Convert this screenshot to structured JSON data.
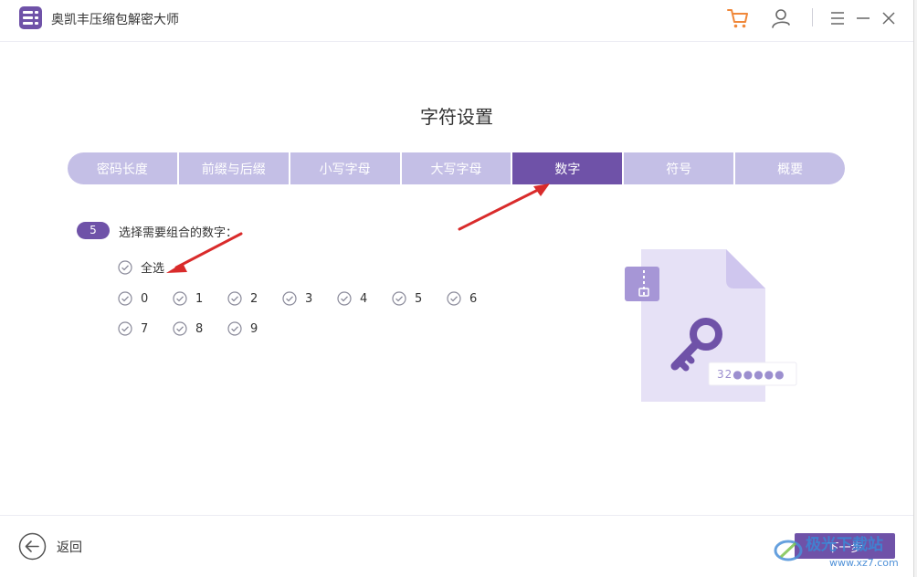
{
  "app": {
    "title": "奥凯丰压缩包解密大师"
  },
  "page": {
    "title": "字符设置"
  },
  "tabs": [
    {
      "label": "密码长度"
    },
    {
      "label": "前缀与后缀"
    },
    {
      "label": "小写字母"
    },
    {
      "label": "大写字母"
    },
    {
      "label": "数字",
      "active": true
    },
    {
      "label": "符号"
    },
    {
      "label": "概要"
    }
  ],
  "step": {
    "number": "5",
    "text": "选择需要组合的数字："
  },
  "select_all": {
    "label": "全选",
    "checked": true
  },
  "digits": [
    {
      "label": "0",
      "checked": true
    },
    {
      "label": "1",
      "checked": true
    },
    {
      "label": "2",
      "checked": true
    },
    {
      "label": "3",
      "checked": true
    },
    {
      "label": "4",
      "checked": true
    },
    {
      "label": "5",
      "checked": true
    },
    {
      "label": "6",
      "checked": true
    },
    {
      "label": "7",
      "checked": true
    },
    {
      "label": "8",
      "checked": true
    },
    {
      "label": "9",
      "checked": true
    }
  ],
  "illustration": {
    "password_hint": "32●●●●●"
  },
  "footer": {
    "back_label": "返回",
    "next_label": "下一步"
  },
  "watermark": {
    "text": "极光下载站",
    "url": "www.xz7.com"
  },
  "icons": {
    "cart": "cart-icon",
    "user": "user-icon",
    "menu": "menu-icon",
    "minimize": "minimize-icon",
    "close": "close-icon",
    "back": "back-arrow-icon"
  },
  "colors": {
    "accent": "#6f52a8",
    "tab_inactive": "#c4bfe6",
    "check": "#6f52a8",
    "cart": "#f0883a",
    "annotation_arrow": "#d92b2b"
  }
}
